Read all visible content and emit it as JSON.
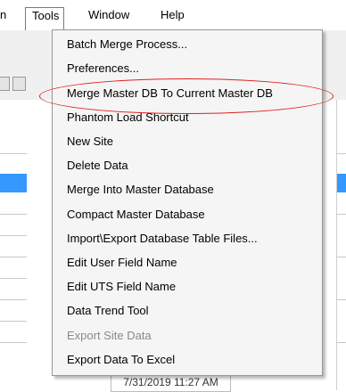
{
  "menubar": {
    "items": [
      {
        "label": "n"
      },
      {
        "label": "Tools"
      },
      {
        "label": "Window"
      },
      {
        "label": "Help"
      }
    ]
  },
  "tools_menu": {
    "items": [
      {
        "label": "Batch Merge Process...",
        "enabled": true
      },
      {
        "label": "Preferences...",
        "enabled": true
      },
      {
        "label": "Merge Master DB To Current Master DB",
        "enabled": true
      },
      {
        "label": "Phantom Load Shortcut",
        "enabled": true
      },
      {
        "label": "New Site",
        "enabled": true
      },
      {
        "label": "Delete Data",
        "enabled": true
      },
      {
        "label": "Merge Into Master Database",
        "enabled": true
      },
      {
        "label": "Compact Master Database",
        "enabled": true
      },
      {
        "label": "Import\\Export Database Table Files...",
        "enabled": true
      },
      {
        "label": "Edit User Field Name",
        "enabled": true
      },
      {
        "label": "Edit UTS Field Name",
        "enabled": true
      },
      {
        "label": "Data Trend Tool",
        "enabled": true
      },
      {
        "label": "Export Site Data",
        "enabled": false
      },
      {
        "label": "Export Data To Excel",
        "enabled": true
      }
    ]
  },
  "background": {
    "timestamp_cell": "7/31/2019 11:27 AM"
  },
  "annotation": {
    "color": "#e02020",
    "target": "Merge Master DB To Current Master DB"
  },
  "colors": {
    "selection": "#3399ff",
    "menu_background": "#f5f5f5",
    "disabled_text": "#8a8a8a"
  }
}
